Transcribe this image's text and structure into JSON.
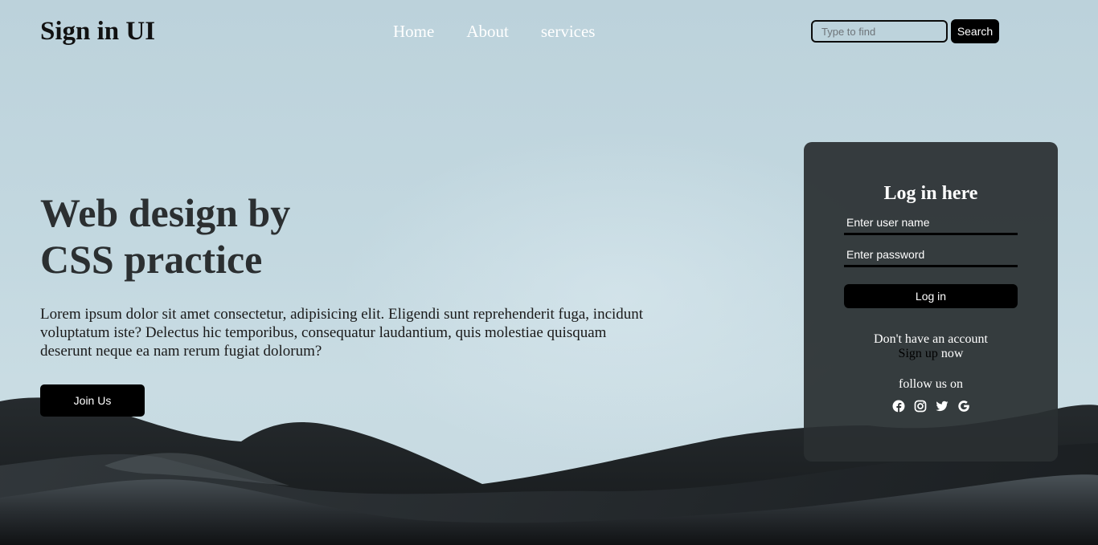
{
  "header": {
    "logo": "Sign in UI",
    "nav": [
      "Home",
      "About",
      "services"
    ],
    "search": {
      "placeholder": "Type to find",
      "button_label": "Search"
    }
  },
  "hero": {
    "title_line1": "Web design by",
    "title_line2": "CSS practice",
    "paragraph": "Lorem ipsum dolor sit amet consectetur, adipisicing elit. Eligendi sunt reprehenderit fuga, incidunt voluptatum iste? Delectus hic temporibus, consequatur laudantium, quis molestiae quisquam deserunt neque ea nam rerum fugiat dolorum?",
    "join_button": "Join Us"
  },
  "login": {
    "title": "Log in here",
    "username_placeholder": "Enter user name",
    "password_placeholder": "Enter password",
    "button_label": "Log in",
    "no_account_text": "Don't have an account",
    "signup_link": "Sign up",
    "signup_suffix": " now",
    "follow_text": "follow us on",
    "socials": [
      "facebook-icon",
      "instagram-icon",
      "twitter-icon",
      "google-icon"
    ]
  },
  "colors": {
    "sky": "#c3d8e0",
    "card": "#2a2f31",
    "button": "#000000",
    "nav_text": "#ffffff",
    "heading": "#2b2f31"
  }
}
